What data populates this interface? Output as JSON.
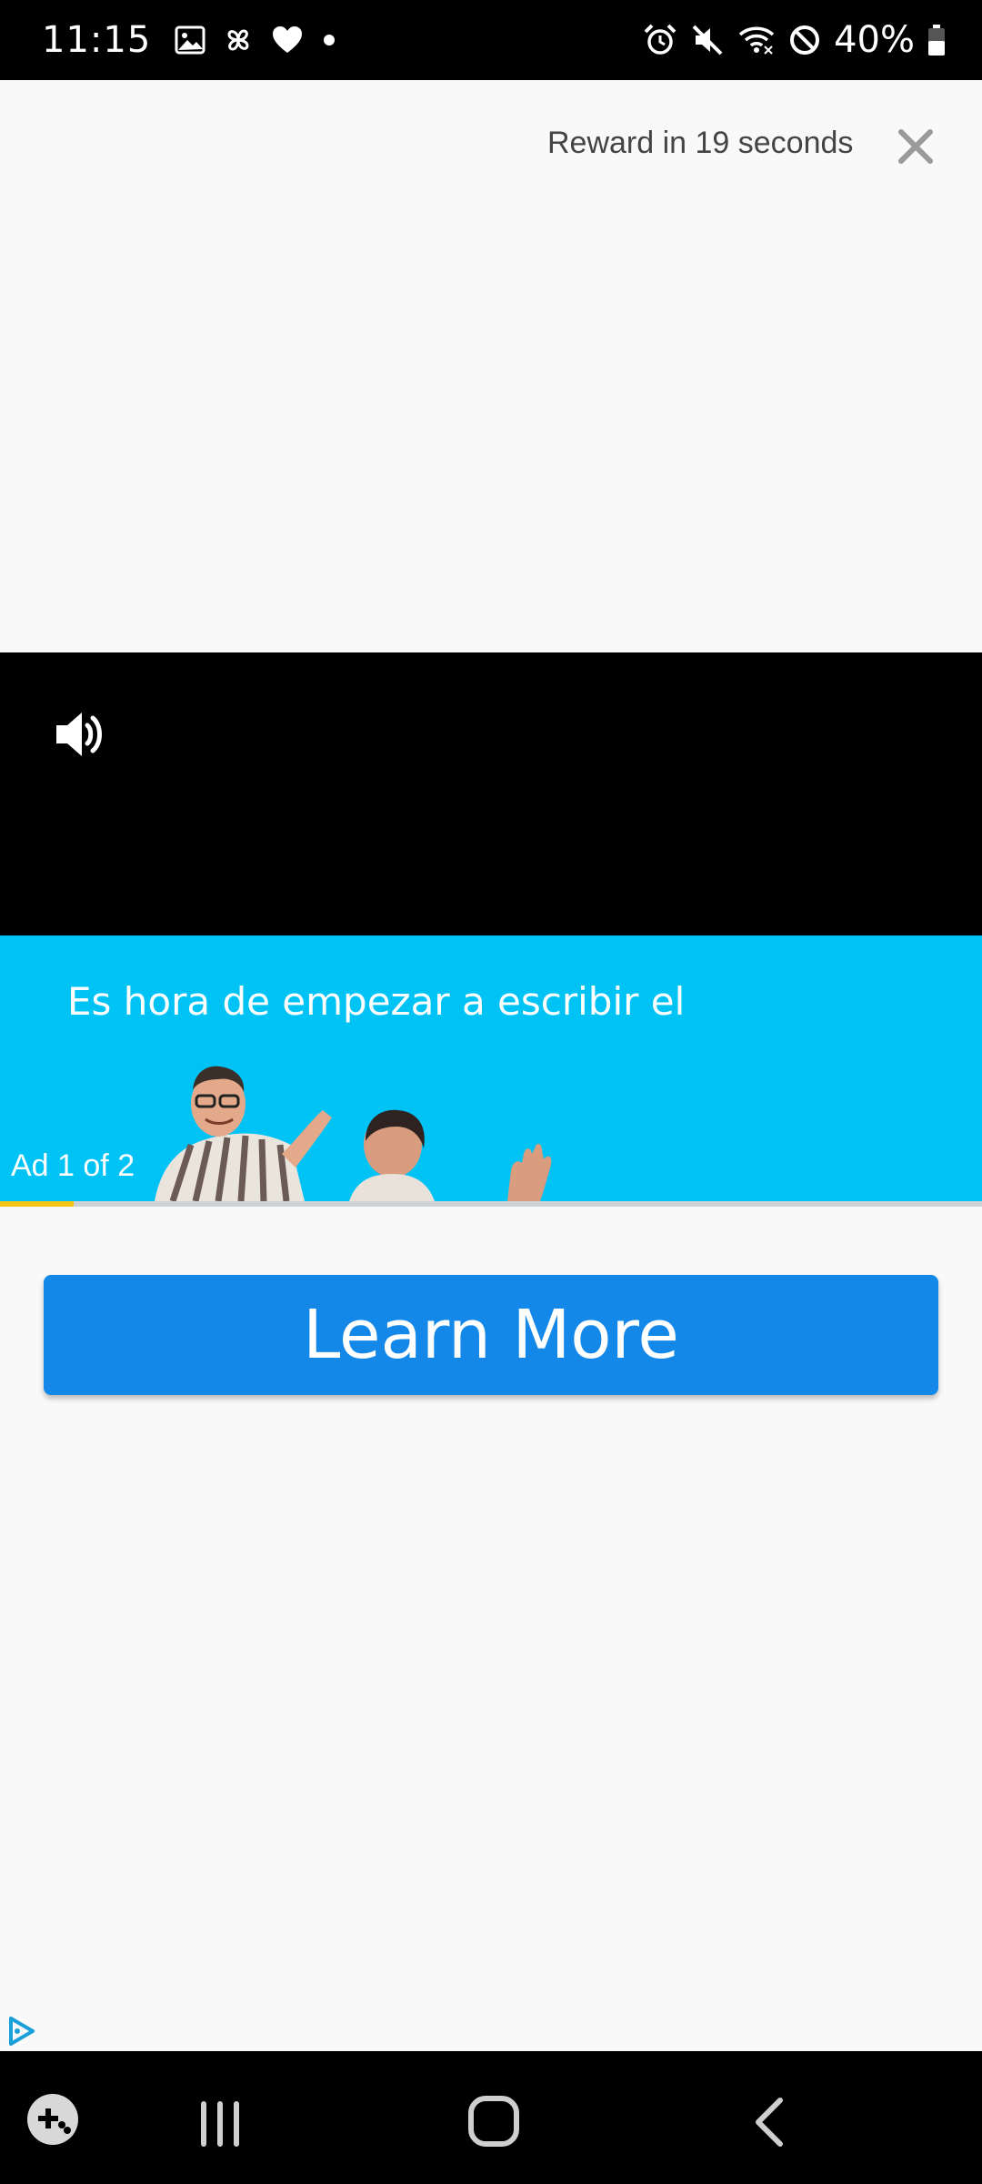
{
  "status_bar": {
    "time": "11:15",
    "battery": "40%",
    "left_icons": [
      "gallery-icon",
      "pinwheel-icon",
      "heart-icon",
      "dot-icon"
    ],
    "right_icons": [
      "alarm-icon",
      "mute-icon",
      "wifi-icon",
      "do-not-disturb-icon",
      "battery-icon"
    ]
  },
  "ad": {
    "reward_text": "Reward in 19 seconds",
    "headline": "Es hora de empezar a escribir el",
    "counter": "Ad 1 of 2",
    "progress_fraction": 0.075,
    "cta_label": "Learn More",
    "cta_color": "#1488e8",
    "video_bg_color": "#00c3f5",
    "progress_color": "#f5c518"
  },
  "nav_bar": {
    "buttons": [
      "game-launcher-icon",
      "recents-icon",
      "home-icon",
      "back-icon"
    ]
  }
}
